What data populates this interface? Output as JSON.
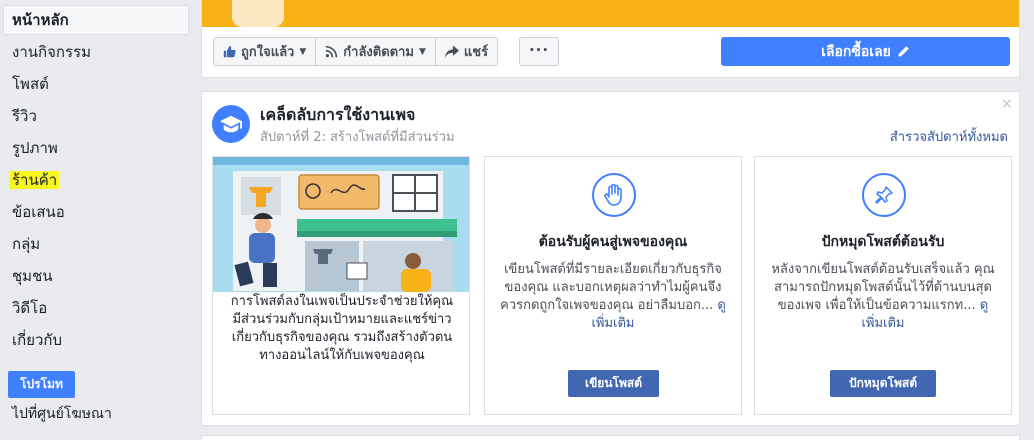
{
  "sidebar": {
    "items": [
      {
        "label": "หน้าหลัก"
      },
      {
        "label": "งานกิจกรรม"
      },
      {
        "label": "โพสต์"
      },
      {
        "label": "รีวิว"
      },
      {
        "label": "รูปภาพ"
      },
      {
        "label": "ร้านค้า"
      },
      {
        "label": "ข้อเสนอ"
      },
      {
        "label": "กลุ่ม"
      },
      {
        "label": "ชุมชน"
      },
      {
        "label": "วิดีโอ"
      },
      {
        "label": "เกี่ยวกับ"
      }
    ],
    "promote_label": "โปรโมท",
    "ads_center_label": "ไปที่ศูนย์โฆษณา"
  },
  "actions": {
    "like_label": "ถูกใจแล้ว",
    "follow_label": "กำลังติดตาม",
    "share_label": "แชร์",
    "more_label": "···",
    "shop_label": "เลือกซื้อเลย"
  },
  "tips": {
    "title": "เคล็ดลับการใช้งานเพจ",
    "subtitle": "สัปดาห์ที่ 2: สร้างโพสต์ที่มีส่วนร่วม",
    "see_all": "สำรวจสัปดาห์ทั้งหมด",
    "close": "×",
    "intro_text": "การโพสต์ลงในเพจเป็นประจำช่วยให้คุณมีส่วนร่วมกับกลุ่มเป้าหมายและแชร์ข่าวเกี่ยวกับธุรกิจของคุณ รวมถึงสร้างตัวตนทางออนไลน์ให้กับเพจของคุณ",
    "cards": [
      {
        "icon": "waving-hand-icon",
        "title": "ต้อนรับผู้คนสู่เพจของคุณ",
        "text": "เขียนโพสต์ที่มีรายละเอียดเกี่ยวกับธุรกิจของคุณ และบอกเหตุผลว่าทำไมผู้คนจึงควรกดถูกใจเพจของคุณ อย่าลืมบอก...",
        "more": "ดูเพิ่มเติม",
        "button": "เขียนโพสต์"
      },
      {
        "icon": "pushpin-icon",
        "title": "ปักหมุดโพสต์ต้อนรับ",
        "text": "หลังจากเขียนโพสต์ต้อนรับเสร็จแล้ว คุณสามารถปักหมุดโพสต์นั้นไว้ที่ด้านบนสุดของเพจ เพื่อให้เป็นข้อความแรกท...",
        "more": "ดูเพิ่มเติม",
        "button": "ปักหมุดโพสต์"
      }
    ]
  },
  "colors": {
    "accent": "#4080ff",
    "button_dark": "#4267b2",
    "link": "#365899",
    "highlight": "#f7f61e",
    "cover": "#f7b217"
  }
}
